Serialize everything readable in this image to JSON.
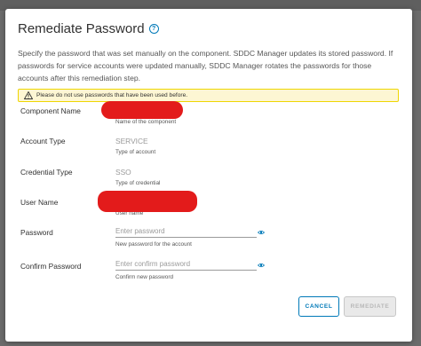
{
  "dialog": {
    "title": "Remediate Password",
    "description": "Specify the password that was set manually on the component. SDDC Manager updates its stored password. If passwords for service accounts were updated manually, SDDC Manager rotates the passwords for those accounts after this remediation step.",
    "alert": "Please do not use passwords that have been used before."
  },
  "fields": {
    "component_name": {
      "label": "Component Name",
      "help": "Name of the component"
    },
    "account_type": {
      "label": "Account Type",
      "value": "SERVICE",
      "help": "Type of account"
    },
    "credential_type": {
      "label": "Credential Type",
      "value": "SSO",
      "help": "Type of credential"
    },
    "user_name": {
      "label": "User Name",
      "help": "User name"
    },
    "password": {
      "label": "Password",
      "placeholder": "Enter password",
      "help": "New password for the account"
    },
    "confirm_password": {
      "label": "Confirm Password",
      "placeholder": "Enter confirm password",
      "help": "Confirm new password"
    }
  },
  "buttons": {
    "cancel": "CANCEL",
    "remediate": "REMEDIATE"
  },
  "colors": {
    "accent": "#0079b8",
    "warning_bg": "#fdf6d3",
    "redaction": "#e31b1b"
  },
  "icons": {
    "help": "help-circle-icon",
    "warning": "warning-triangle-icon",
    "eye": "eye-icon"
  }
}
